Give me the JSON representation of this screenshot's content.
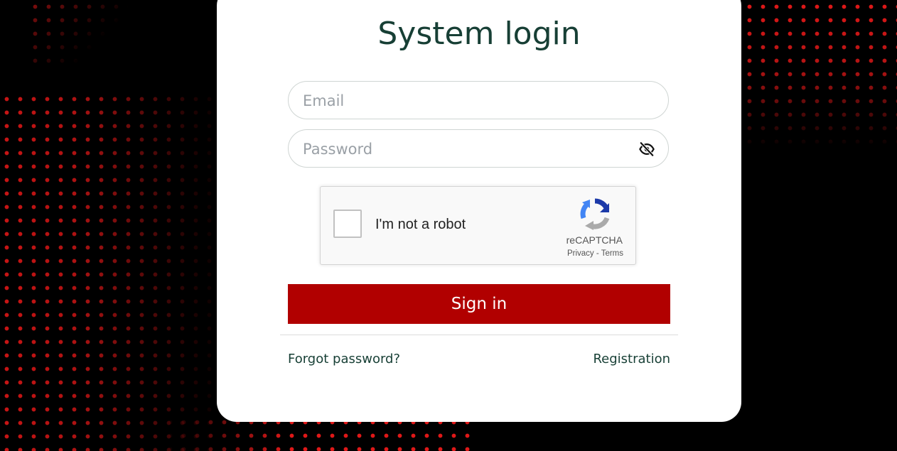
{
  "page": {
    "title": "System login"
  },
  "form": {
    "email_placeholder": "Email",
    "password_placeholder": "Password",
    "password_toggle_icon": "eye-off-icon",
    "submit_label": "Sign in"
  },
  "recaptcha": {
    "label": "I'm not a robot",
    "brand": "reCAPTCHA",
    "privacy_label": "Privacy",
    "separator": " - ",
    "terms_label": "Terms",
    "checked": false
  },
  "links": {
    "forgot_password": "Forgot password?",
    "registration": "Registration"
  },
  "colors": {
    "accent": "#b10000",
    "heading": "#173f35",
    "background": "#000000",
    "dots": "#e01818"
  }
}
